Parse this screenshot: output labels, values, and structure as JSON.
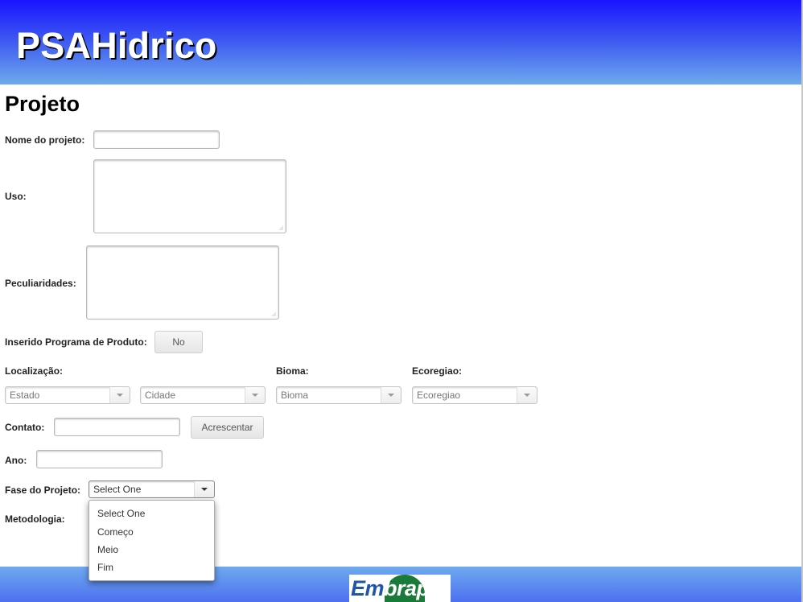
{
  "header": {
    "title": "PSAHidrico"
  },
  "page": {
    "title": "Projeto"
  },
  "form": {
    "nome_label": "Nome do projeto:",
    "nome_value": "",
    "uso_label": "Uso:",
    "uso_value": "",
    "peculiaridades_label": "Peculiaridades:",
    "peculiaridades_value": "",
    "inserido_label": "Inserido Programa de Produto:",
    "inserido_toggle": "No",
    "localizacao_label": "Localização:",
    "estado_select": "Estado",
    "cidade_select": "Cidade",
    "bioma_label": "Bioma:",
    "bioma_select": "Bioma",
    "ecoregiao_label": "Ecoregiao:",
    "ecoregiao_select": "Ecoregiao",
    "contato_label": "Contato:",
    "contato_value": "",
    "acrescentar_button": "Acrescentar",
    "ano_label": "Ano:",
    "ano_value": "",
    "fase_label": "Fase do Projeto:",
    "fase_selected": "Select One",
    "fase_options": [
      "Select One",
      "Começo",
      "Meio",
      "Fim"
    ],
    "metodologia_label": "Metodologia:"
  },
  "footer": {
    "logo_text_a": "Em",
    "logo_text_b": "brapa"
  },
  "colors": {
    "header_top": "#1a14ff",
    "header_bottom": "#6eaaee",
    "logo_blue": "#1f56a8",
    "logo_green": "#1a7a3a"
  }
}
